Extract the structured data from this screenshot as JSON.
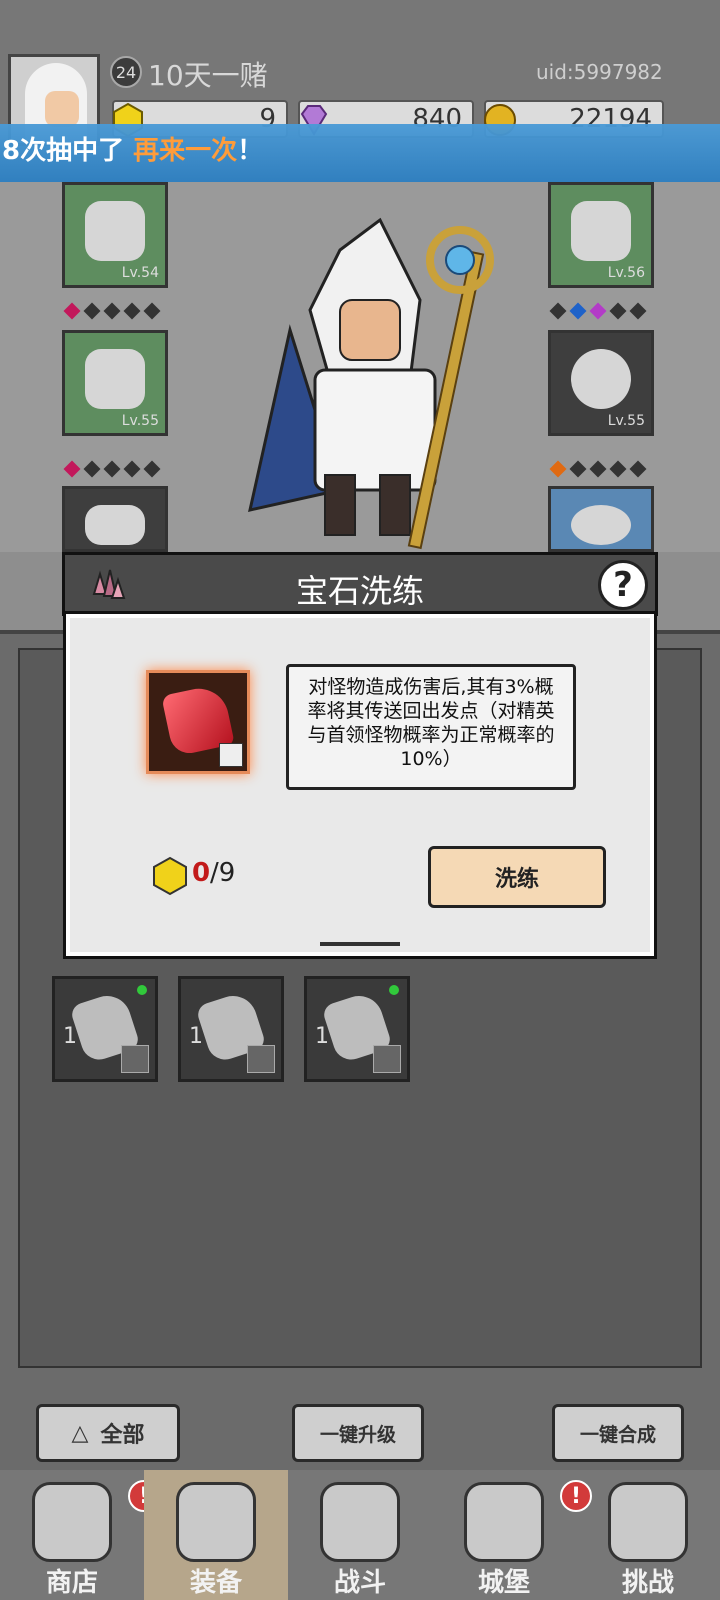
{
  "header": {
    "player_level": "24",
    "player_name": "10天一赌",
    "uid": "uid:5997982",
    "currencies": [
      {
        "name": "yellow-gem",
        "value": "9",
        "color": "#f0d21a"
      },
      {
        "name": "purple-diamond",
        "value": "840",
        "color": "#b27ad6"
      },
      {
        "name": "gold-coin",
        "value": "22194",
        "color": "#e2b322"
      }
    ]
  },
  "marquee": {
    "prefix": "8次抽中了 ",
    "highlight": "再来一次",
    "suffix": "！"
  },
  "equipment": {
    "left_top_lv": "Lv.54",
    "left_mid_lv": "Lv.55",
    "right_top_lv": "Lv.56",
    "right_mid_lv": "Lv.55"
  },
  "inventory": {
    "items": [
      {
        "qty": "1"
      },
      {
        "qty": "1"
      },
      {
        "qty": "1"
      }
    ]
  },
  "actions": {
    "all_label": "全部",
    "upgrade_all_label": "一键升级",
    "merge_all_label": "一键合成"
  },
  "nav": {
    "items": [
      {
        "label": "商店"
      },
      {
        "label": "装备"
      },
      {
        "label": "战斗"
      },
      {
        "label": "城堡"
      },
      {
        "label": "挑战"
      }
    ],
    "alert_symbol": "!"
  },
  "modal": {
    "title": "宝石洗练",
    "help_symbol": "?",
    "description": "对怪物造成伤害后,其有3%概率将其传送回出发点（对精英与首领怪物概率为正常概率的10%）",
    "cost_have": "0",
    "cost_need": "/9",
    "refine_label": "洗练"
  }
}
